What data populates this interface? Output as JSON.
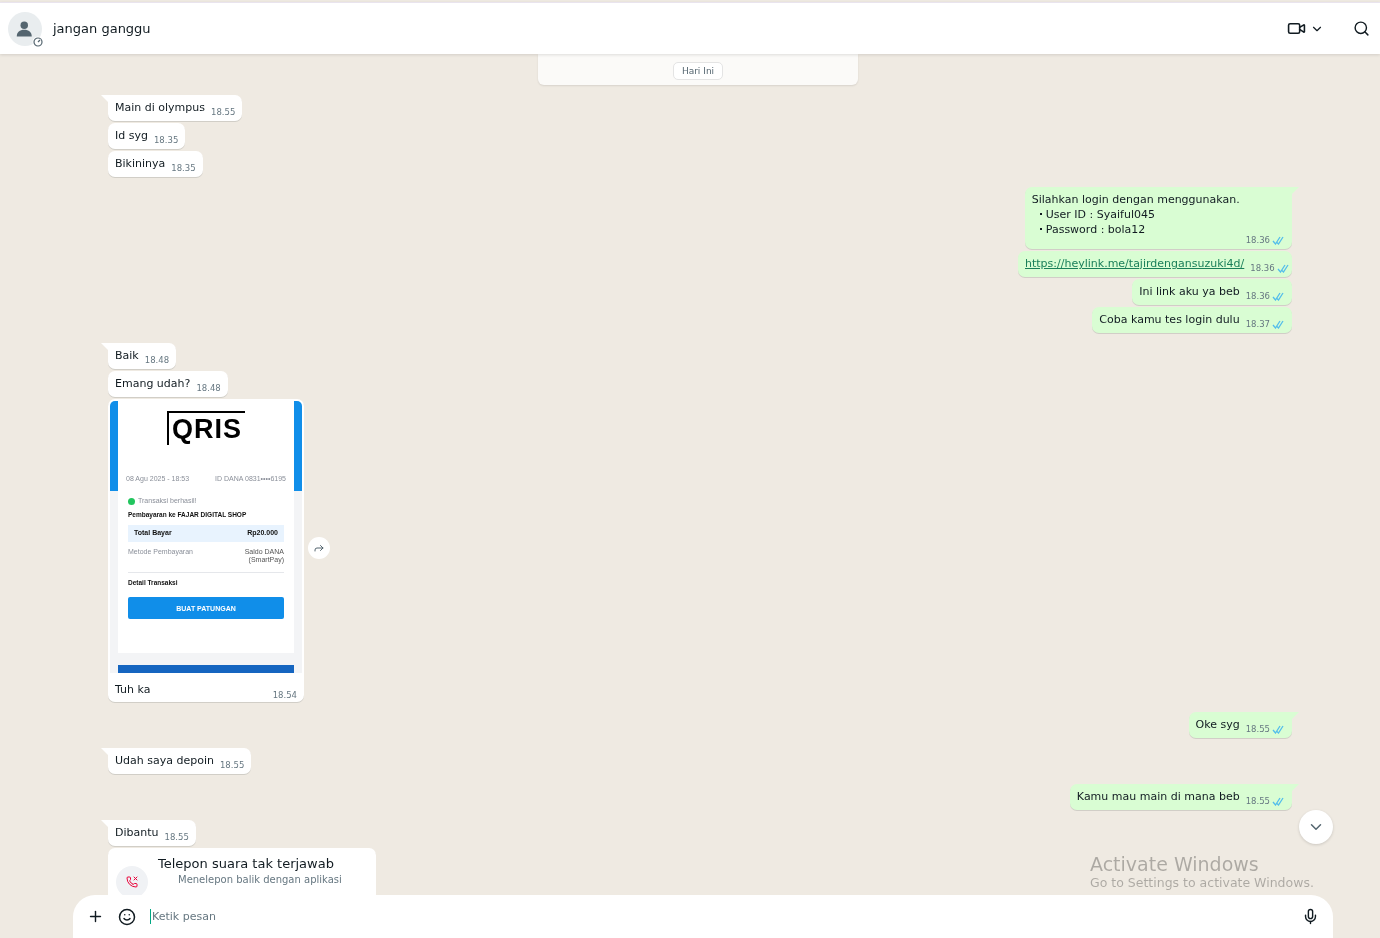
{
  "header": {
    "contact_name": "jangan ganggu"
  },
  "date_chip": "Hari Ini",
  "messages": [
    {
      "outgoing": false,
      "kind": "text",
      "tail": true,
      "text": "Main di olympus",
      "time": "18.55"
    },
    {
      "outgoing": false,
      "kind": "text",
      "tail": false,
      "text": "Id syg",
      "time": "18.35"
    },
    {
      "outgoing": false,
      "kind": "text",
      "tail": false,
      "text": "Bikininya",
      "time": "18.35"
    },
    {
      "outgoing": true,
      "kind": "list",
      "tail": true,
      "text": "Silahkan login dengan menggunakan.",
      "items": [
        "User ID : Syaiful045",
        "Password : bola12"
      ],
      "time": "18.36",
      "read": true
    },
    {
      "outgoing": true,
      "kind": "link",
      "tail": false,
      "text": "https://heylink.me/tajirdengansuzuki4d/",
      "time": "18.36",
      "read": true
    },
    {
      "outgoing": true,
      "kind": "text",
      "tail": false,
      "text": "Ini link aku ya beb",
      "time": "18.36",
      "read": true
    },
    {
      "outgoing": true,
      "kind": "text",
      "tail": false,
      "text": "Coba kamu tes login dulu",
      "time": "18.37",
      "read": true
    },
    {
      "outgoing": false,
      "kind": "text",
      "tail": true,
      "text": "Baik",
      "time": "18.48"
    },
    {
      "outgoing": false,
      "kind": "text",
      "tail": false,
      "text": "Emang udah?",
      "time": "18.48"
    },
    {
      "outgoing": false,
      "kind": "image",
      "tail": false,
      "text": "Tuh ka",
      "time": "18.54",
      "receipt": {
        "logo": "QRIS",
        "date": "08 Agu 2025 - 18:53",
        "account": "ID DANA 0831••••6195",
        "status": "Transaksi berhasil!",
        "payee": "Pembayaran ke FAJAR DIGITAL SHOP",
        "total_label": "Total Bayar",
        "total": "Rp20.000",
        "method_label": "Metode Pembayaran",
        "method": "Saldo DANA (SmartPay)",
        "details": "Detail Transaksi",
        "button": "BUAT PATUNGAN"
      }
    },
    {
      "outgoing": true,
      "kind": "text",
      "tail": true,
      "text": "Oke syg",
      "time": "18.55",
      "read": true
    },
    {
      "outgoing": false,
      "kind": "text",
      "tail": true,
      "text": "Udah saya depoin",
      "time": "18.55"
    },
    {
      "outgoing": true,
      "kind": "text",
      "tail": true,
      "text": "Kamu mau main di mana beb",
      "time": "18.55",
      "read": true
    },
    {
      "outgoing": false,
      "kind": "text",
      "tail": true,
      "text": "Dibantu",
      "time": "18.55"
    },
    {
      "outgoing": false,
      "kind": "call",
      "tail": false,
      "text": "Telepon suara tak terjawab",
      "subtitle": "Menelepon balik dengan aplikasi"
    }
  ],
  "composer": {
    "placeholder": "Ketik pesan"
  },
  "system_overlay": {
    "title": "Activate Windows",
    "subtitle": "Go to Settings to activate Windows."
  }
}
